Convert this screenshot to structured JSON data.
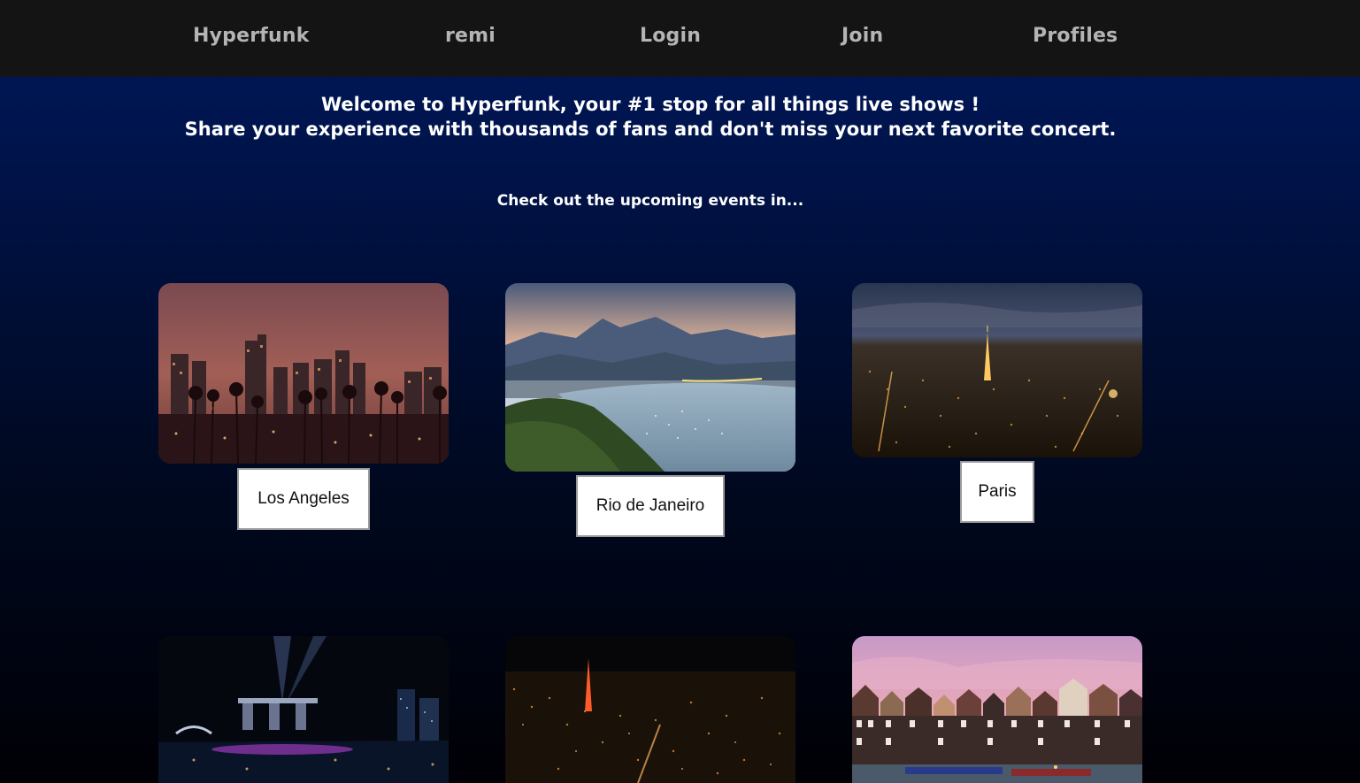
{
  "nav": {
    "brand": "Hyperfunk",
    "user": "remi",
    "login": "Login",
    "join": "Join",
    "profiles": "Profiles"
  },
  "welcome": {
    "line1": "Welcome to Hyperfunk, your #1 stop for all things live shows !",
    "line2": "Share your experience with thousands of fans and don't miss your next favorite concert."
  },
  "subheading": "Check out the upcoming events in...",
  "cities": [
    {
      "name": "Los Angeles"
    },
    {
      "name": "Rio de Janeiro"
    },
    {
      "name": "Paris"
    }
  ],
  "colors": {
    "navbar_bg": "#141414",
    "nav_text": "#b4b4b4",
    "page_bg_top": "#001a5e",
    "page_bg_bottom": "#000005"
  }
}
